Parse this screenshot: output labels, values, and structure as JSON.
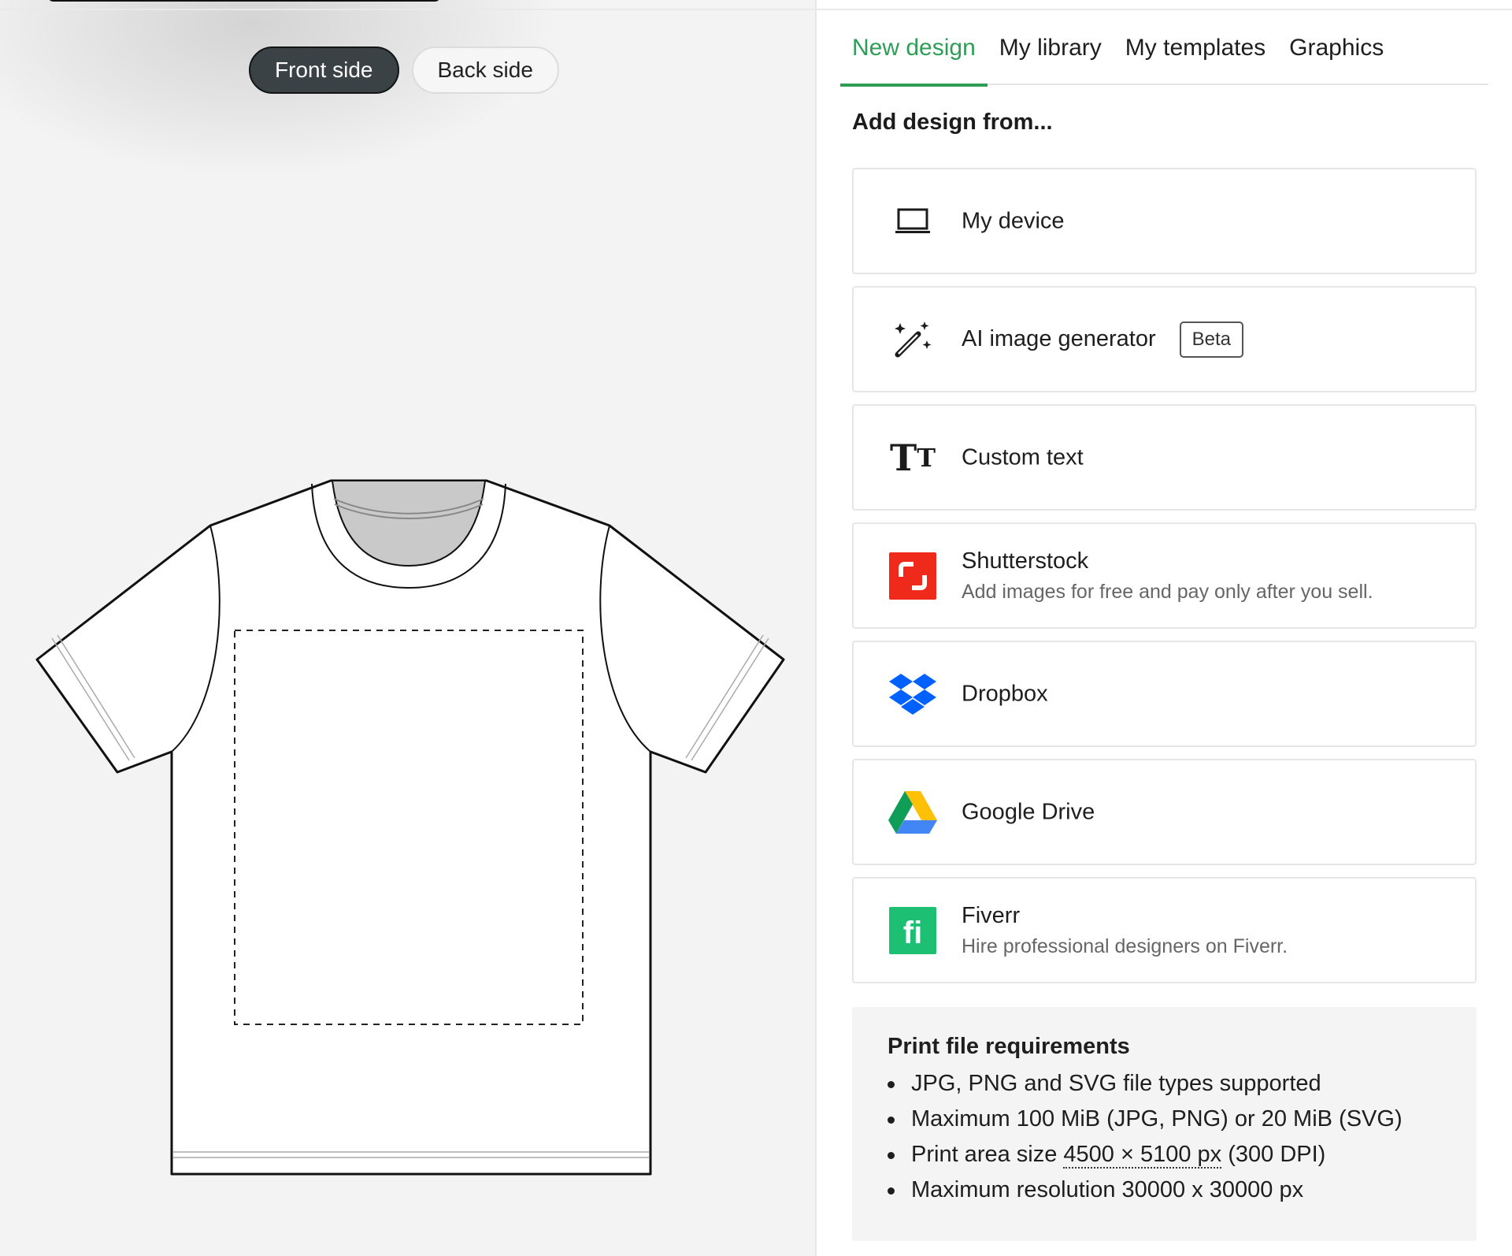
{
  "canvas": {
    "side_toggle": {
      "front_label": "Front side",
      "back_label": "Back side",
      "selected": "front"
    }
  },
  "tabs": [
    {
      "label": "New design",
      "active": true
    },
    {
      "label": "My library",
      "active": false
    },
    {
      "label": "My templates",
      "active": false
    },
    {
      "label": "Graphics",
      "active": false
    }
  ],
  "add_design": {
    "heading": "Add design from...",
    "sources": [
      {
        "id": "my-device",
        "title": "My device",
        "icon": "laptop-icon"
      },
      {
        "id": "ai-image-generator",
        "title": "AI image generator",
        "badge": "Beta",
        "icon": "magic-wand-icon"
      },
      {
        "id": "custom-text",
        "title": "Custom text",
        "icon": "text-size-icon",
        "icon_glyph": "TT"
      },
      {
        "id": "shutterstock",
        "title": "Shutterstock",
        "subtitle": "Add images for free and pay only after you sell.",
        "icon": "shutterstock-icon"
      },
      {
        "id": "dropbox",
        "title": "Dropbox",
        "icon": "dropbox-icon"
      },
      {
        "id": "google-drive",
        "title": "Google Drive",
        "icon": "google-drive-icon"
      },
      {
        "id": "fiverr",
        "title": "Fiverr",
        "subtitle": "Hire professional designers on Fiverr.",
        "icon": "fiverr-icon",
        "icon_glyph": "fi"
      }
    ]
  },
  "requirements": {
    "title": "Print file requirements",
    "items": [
      {
        "text": "JPG, PNG and SVG file types supported"
      },
      {
        "text": "Maximum 100 MiB (JPG, PNG) or 20 MiB (SVG)"
      },
      {
        "prefix": "Print area size ",
        "highlight": "4500 × 5100 px",
        "suffix": " (300 DPI)"
      },
      {
        "text": "Maximum resolution 30000 x 30000 px"
      }
    ]
  },
  "colors": {
    "accent_green": "#2e9e57",
    "active_toggle_bg": "#3a4246",
    "shutterstock_red": "#f02a1a",
    "dropbox_blue": "#0061fe",
    "fiverr_green": "#1dbf73"
  }
}
